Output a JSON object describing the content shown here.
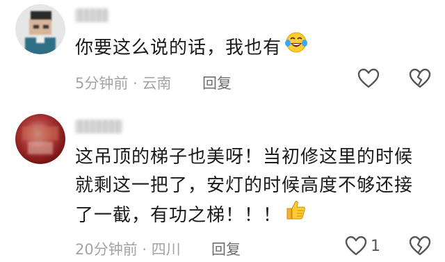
{
  "comments": [
    {
      "username": "",
      "text_lines": [
        "你要这么说的话，我也有"
      ],
      "emoji": "laughing-crying-emoji",
      "time": "5分钟前",
      "separator": "·",
      "location": "云南",
      "reply_label": "回复",
      "like_count": ""
    },
    {
      "username": "",
      "text_lines": [
        "这吊顶的梯子也美呀！当初修这里的时候",
        "就剩这一把了，安灯的时候高度不够还接",
        "了一截，有功之梯！！！"
      ],
      "emoji": "thumbs-up-emoji",
      "time": "20分钟前",
      "separator": "·",
      "location": "四川",
      "reply_label": "回复",
      "like_count": "1"
    }
  ],
  "icons": {
    "like": "heart-outline-icon",
    "dislike": "broken-heart-outline-icon"
  },
  "colors": {
    "meta": "#a3a3a3",
    "reply": "#6e6e6e",
    "text": "#1a1a1a",
    "icon": "#555555"
  }
}
